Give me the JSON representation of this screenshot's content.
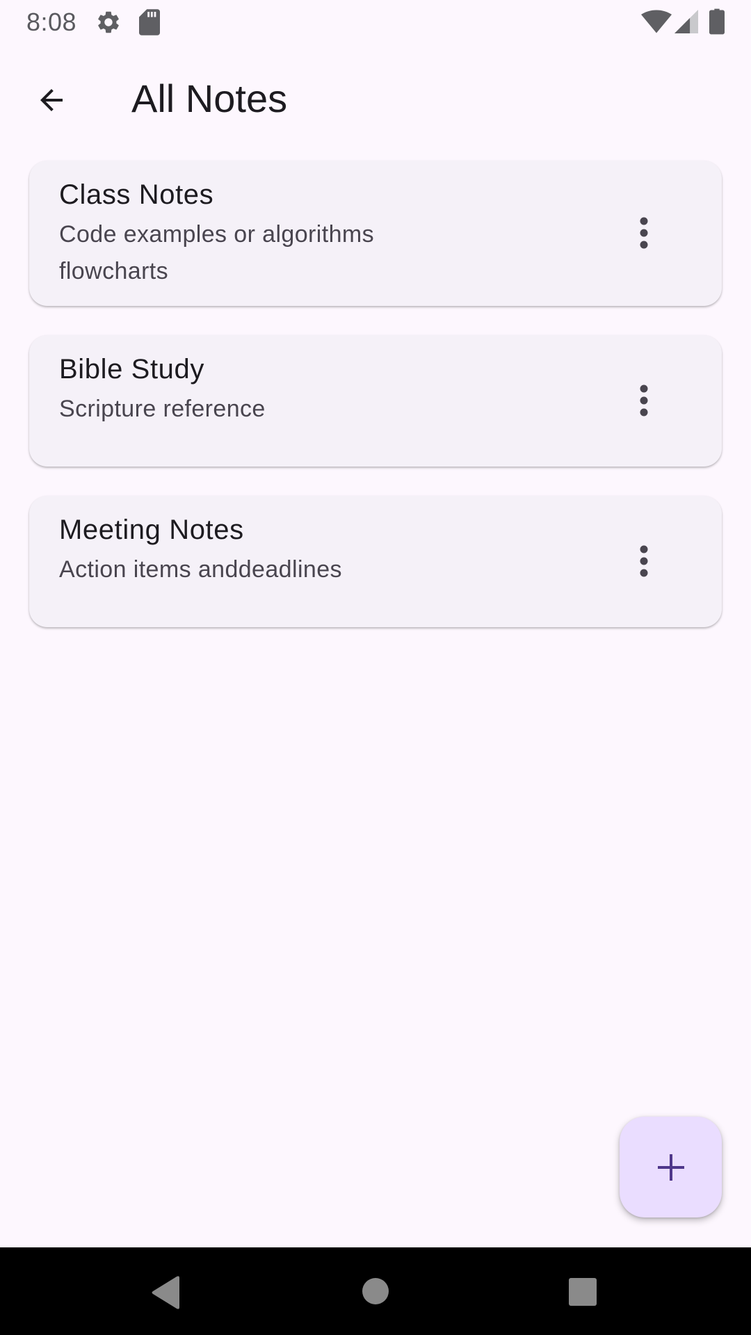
{
  "status_bar": {
    "time": "8:08",
    "icons": [
      "gear-icon",
      "sd-card-icon",
      "wifi-icon",
      "signal-icon",
      "battery-icon"
    ],
    "icon_color": "#5f5f63"
  },
  "app_bar": {
    "back_icon": "arrow-back-icon",
    "title": "All Notes"
  },
  "notes": [
    {
      "title": "Class Notes",
      "subtitle": "Code examples or algorithms flowcharts",
      "menu_icon": "more-vert-icon"
    },
    {
      "title": "Bible Study",
      "subtitle": "Scripture reference",
      "menu_icon": "more-vert-icon"
    },
    {
      "title": "Meeting Notes",
      "subtitle": "Action items anddeadlines",
      "menu_icon": "more-vert-icon"
    }
  ],
  "fab": {
    "icon": "add-icon",
    "background": "#eaddff",
    "icon_color": "#4f378b"
  },
  "nav_bar": {
    "icons": [
      "nav-back-icon",
      "nav-home-icon",
      "nav-recents-icon"
    ],
    "background": "#000000"
  },
  "colors": {
    "background": "#fdf7fe",
    "card": "#f5f1f8",
    "text_primary": "#1d1b20",
    "text_secondary": "#49454f"
  }
}
